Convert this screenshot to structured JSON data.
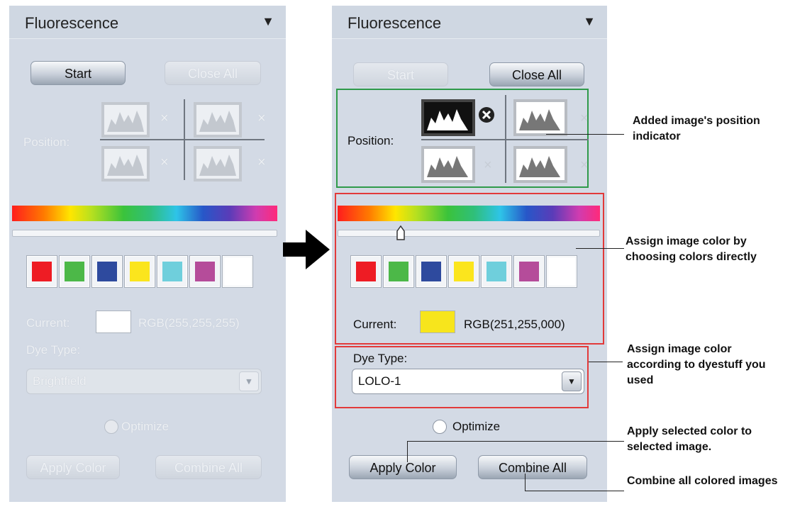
{
  "left_panel": {
    "title": "Fluorescence",
    "start_label": "Start",
    "close_all_label": "Close All",
    "position_label": "Position:",
    "current_label": "Current:",
    "current_rgb": "RGB(255,255,255)",
    "current_color": "#ffffff",
    "dye_type_label": "Dye Type:",
    "dye_type_value": "Brightfield",
    "optimize_label": "Optimize",
    "apply_color_label": "Apply Color",
    "combine_all_label": "Combine All"
  },
  "right_panel": {
    "title": "Fluorescence",
    "start_label": "Start",
    "close_all_label": "Close All",
    "position_label": "Position:",
    "current_label": "Current:",
    "current_rgb": "RGB(251,255,000)",
    "current_color": "#f7e51c",
    "dye_type_label": "Dye Type:",
    "dye_type_value": "LOLO-1",
    "optimize_label": "Optimize",
    "apply_color_label": "Apply Color",
    "combine_all_label": "Combine All"
  },
  "swatch_colors": [
    "#ee1c24",
    "#4cb848",
    "#2e4a9e",
    "#fbe51d",
    "#6fcfdc",
    "#b54c9a",
    "#ffffff"
  ],
  "annotations": {
    "position_indicator": "Added image's position indicator",
    "choose_colors": "Assign image color by choosing colors directly",
    "dyestuff": "Assign image color according to dyestuff you used",
    "apply_selected": "Apply selected color to selected image.",
    "combine_colored": "Combine all colored images"
  },
  "colors": {
    "green_frame": "#2f9a4a",
    "red_frame": "#e23a3a",
    "panel_bg": "#d3dae5"
  }
}
